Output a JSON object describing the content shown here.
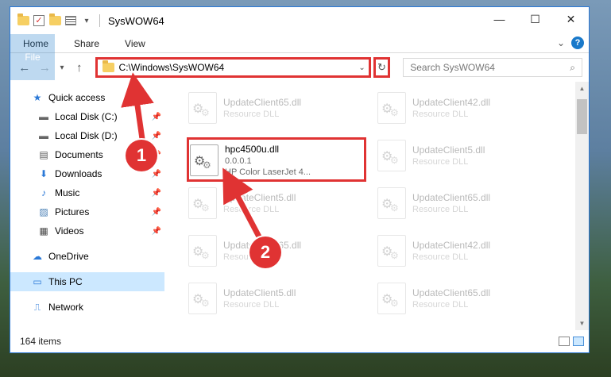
{
  "window": {
    "title": "SysWOW64",
    "controls": {
      "minimize": "—",
      "maximize": "☐",
      "close": "✕"
    }
  },
  "ribbon": {
    "tabs": [
      "File",
      "Home",
      "Share",
      "View"
    ],
    "expand": "⌄",
    "help": "?"
  },
  "nav": {
    "back": "←",
    "forward": "→",
    "up_dropdown": "▾",
    "up": "↑"
  },
  "address": {
    "path": "C:\\Windows\\SysWOW64",
    "dropdown": "⌄",
    "refresh": "↻"
  },
  "search": {
    "placeholder": "Search SysWOW64",
    "icon": "⌕"
  },
  "sidebar": {
    "items": [
      {
        "label": "Quick access",
        "icon": "★",
        "pinned": false
      },
      {
        "label": "Local Disk (C:)",
        "icon": "▬",
        "pinned": true
      },
      {
        "label": "Local Disk (D:)",
        "icon": "▬",
        "pinned": true
      },
      {
        "label": "Documents",
        "icon": "▤",
        "pinned": true
      },
      {
        "label": "Downloads",
        "icon": "⬇",
        "pinned": true
      },
      {
        "label": "Music",
        "icon": "♪",
        "pinned": true
      },
      {
        "label": "Pictures",
        "icon": "▨",
        "pinned": true
      },
      {
        "label": "Videos",
        "icon": "▦",
        "pinned": true
      },
      {
        "label": "OneDrive",
        "icon": "☁"
      },
      {
        "label": "This PC",
        "icon": "▭"
      },
      {
        "label": "Network",
        "icon": "⎍"
      }
    ],
    "pin_glyph": "📌"
  },
  "files": [
    {
      "name": "UpdateClient65.dll",
      "desc": "Resource DLL",
      "active": false
    },
    {
      "name": "UpdateClient42.dll",
      "desc": "Resource DLL",
      "active": false
    },
    {
      "name": "hpc4500u.dll",
      "version": "0.0.0.1",
      "desc": "HP Color LaserJet 4...",
      "active": true
    },
    {
      "name": "UpdateClient5.dll",
      "desc": "Resource DLL",
      "active": false
    },
    {
      "name": "UpdateClient5.dll",
      "desc": "Resource DLL",
      "active": false
    },
    {
      "name": "UpdateClient65.dll",
      "desc": "Resource DLL",
      "active": false
    },
    {
      "name": "UpdateClient65.dll",
      "desc": "Resource DLL",
      "active": false
    },
    {
      "name": "UpdateClient42.dll",
      "desc": "Resource DLL",
      "active": false
    },
    {
      "name": "UpdateClient5.dll",
      "desc": "Resource DLL",
      "active": false
    },
    {
      "name": "UpdateClient65.dll",
      "desc": "Resource DLL",
      "active": false
    }
  ],
  "status": {
    "count": "164 items"
  },
  "annotations": {
    "step1": "1",
    "step2": "2"
  },
  "colors": {
    "highlight": "#e03333",
    "accent": "#1979ca",
    "selected": "#cce8ff"
  }
}
